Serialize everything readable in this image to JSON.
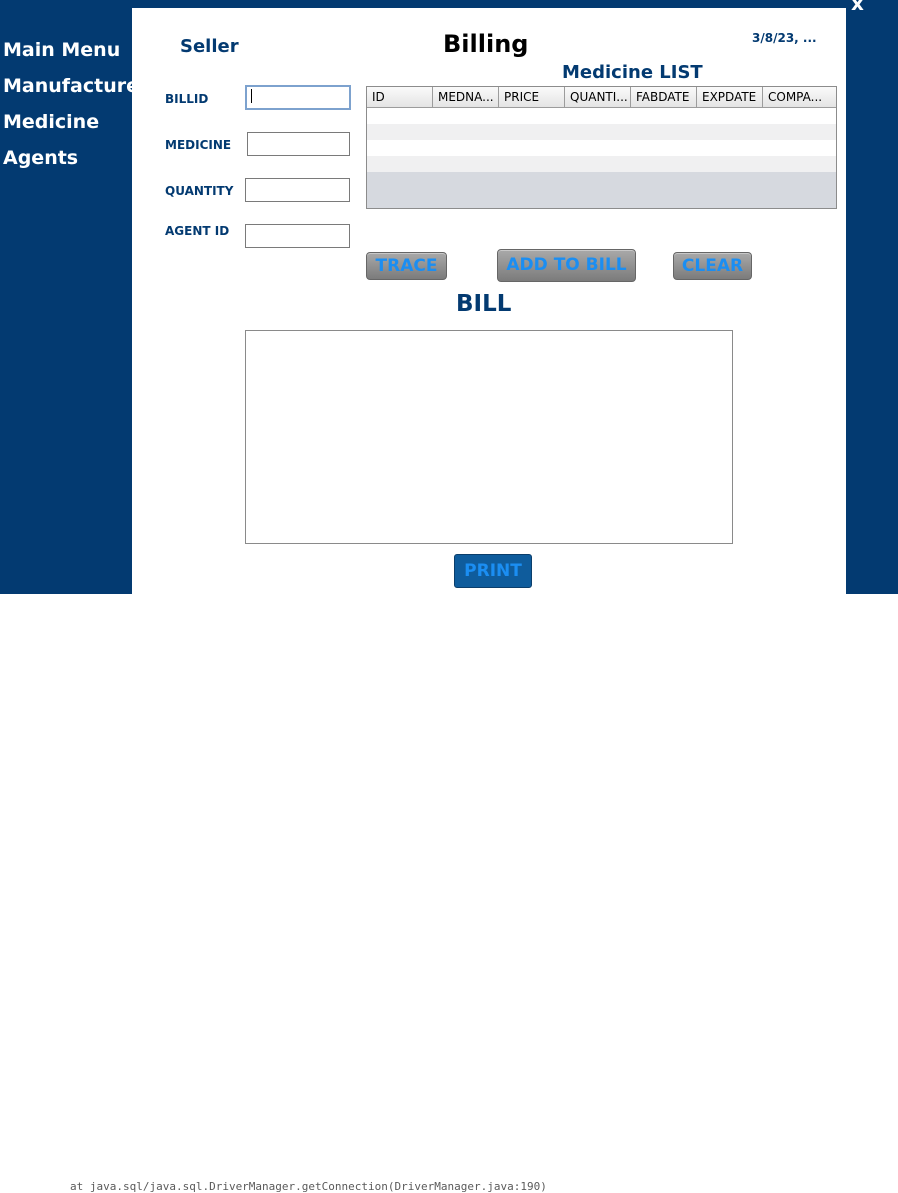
{
  "window": {
    "close_label": "x"
  },
  "sidebar": {
    "items": [
      {
        "label": "Main Menu"
      },
      {
        "label": "Manufacturer"
      },
      {
        "label": "Medicine"
      },
      {
        "label": "Agents"
      }
    ]
  },
  "header": {
    "seller_label": "Seller",
    "title": "Billing",
    "date": "3/8/23, ..."
  },
  "form": {
    "billid_label": "BILLID",
    "billid_value": "",
    "medicine_label": "MEDICINE",
    "medicine_value": "",
    "quantity_label": "QUANTITY",
    "quantity_value": "",
    "agent_id_label": "AGENT ID",
    "agent_id_value": ""
  },
  "medicine_table": {
    "title": "Medicine LIST",
    "columns": [
      "ID",
      "MEDNA...",
      "PRICE",
      "QUANTI...",
      "FABDATE",
      "EXPDATE",
      "COMPA..."
    ],
    "rows": []
  },
  "actions": {
    "trace_label": "TRACE",
    "add_label": "ADD TO BILL",
    "clear_label": "CLEAR"
  },
  "bill": {
    "title": "BILL",
    "content": "",
    "print_label": "PRINT"
  },
  "background": {
    "code_text": "at java.sql/java.sql.DriverManager.getConnection(DriverManager.java:190)"
  },
  "colors": {
    "frame": "#033a71",
    "accent_text": "#1b8ef2",
    "label_text": "#033a71"
  }
}
